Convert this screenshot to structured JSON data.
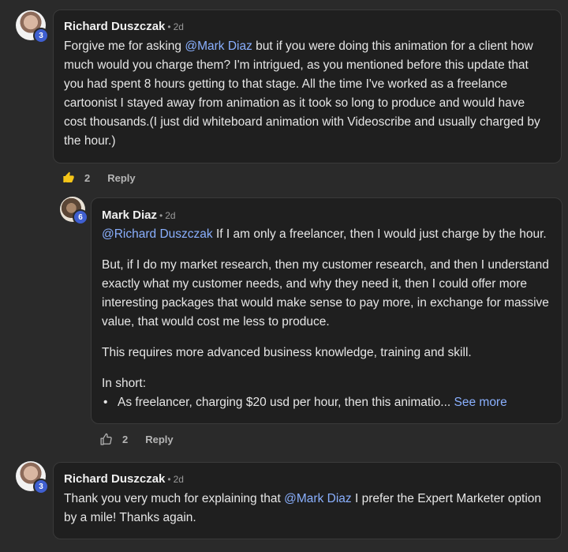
{
  "comments": [
    {
      "author": "Richard Duszczak",
      "time": "2d",
      "level": "3",
      "text_before": "Forgive me for asking ",
      "mention": "@Mark Diaz",
      "text_after": " but if you were doing this animation for a client how much would you charge them? I'm intrigued, as you mentioned before this update that you had spent 8 hours getting to that stage. All the time I've worked as a freelance cartoonist I stayed away from animation as it took so long to produce and would have cost thousands.(I just did whiteboard animation with Videoscribe and usually charged by the hour.)",
      "likes": "2",
      "reply_label": "Reply",
      "liked": true
    },
    {
      "author": "Mark Diaz",
      "time": "2d",
      "level": "6",
      "mention": "@Richard Duszczak",
      "p1_after": " If I am only a freelancer, then I would just charge by the hour.",
      "p2": "But, if I do my market research, then my customer research, and then I understand exactly what my customer needs, and why they need it, then I could offer more interesting packages that would make sense to pay more, in exchange for massive value, that would cost me less to produce.",
      "p3": "This requires more advanced business knowledge, training and skill.",
      "p4": "In short:",
      "bullet": "As freelancer, charging $20 usd per hour, then this animatio...",
      "see_more": "See more",
      "likes": "2",
      "reply_label": "Reply",
      "liked": false
    },
    {
      "author": "Richard Duszczak",
      "time": "2d",
      "level": "3",
      "text_before": "Thank you very much for explaining that ",
      "mention": "@Mark Diaz",
      "text_after": " I prefer the Expert Marketer option by a mile! Thanks again."
    }
  ],
  "colors": {
    "background": "#2a2a2a",
    "bubble": "#1f1f1f",
    "mention": "#8ab0ff",
    "level_badge": "#3f5fd0",
    "like_active": "#f5c518"
  },
  "icons": [
    "thumbs-up-icon"
  ]
}
